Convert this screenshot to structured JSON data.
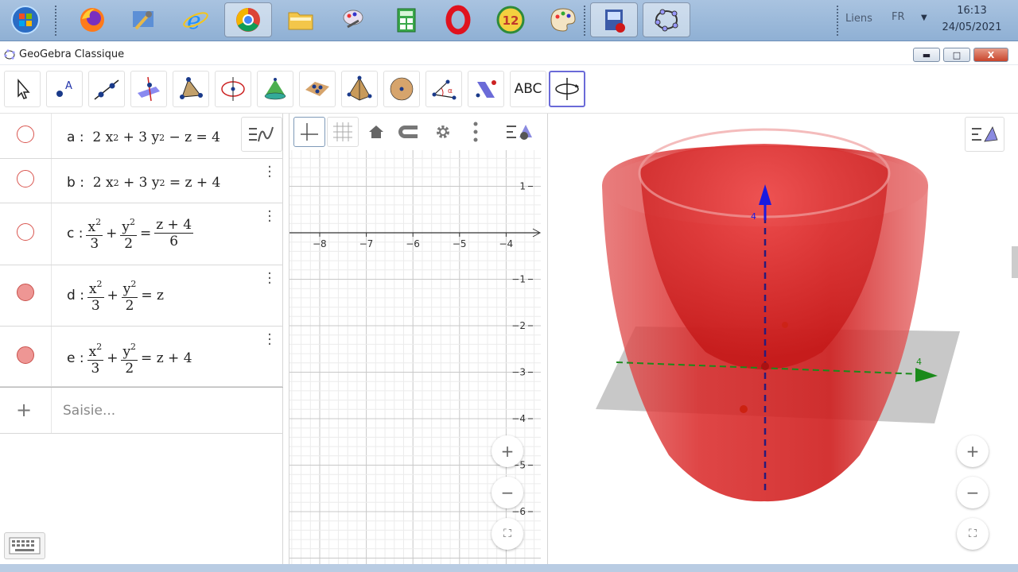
{
  "taskbar": {
    "apps": [
      "start-orb-icon",
      "firefox-icon",
      "app-settings-icon",
      "internet-explorer-icon",
      "chrome-icon",
      "folder-icon",
      "paint-icon",
      "calculator-icon",
      "opera-icon",
      "badge-12-icon",
      "palette-icon",
      "video-editor-icon",
      "geogebra-icon"
    ],
    "badge_number": "12",
    "links_label": "Liens",
    "language": "FR",
    "time": "16:13",
    "date": "24/05/2021"
  },
  "window": {
    "title": "GeoGebra Classique",
    "minimize_label": "▬",
    "maximize_label": "□",
    "close_label": "X"
  },
  "toolbar": {
    "tools": [
      "move-tool-icon",
      "point-tool-icon",
      "line-tool-icon",
      "perpendicular-tool-icon",
      "polygon-tool-icon",
      "circle-tool-icon",
      "cone-tool-icon",
      "plane-tool-icon",
      "pyramid-tool-icon",
      "sphere-tool-icon",
      "angle-tool-icon",
      "reflect-tool-icon",
      "text-tool",
      "rotate-view-tool-icon"
    ],
    "text_tool_label": "ABC",
    "undo_icon": "undo-icon",
    "redo_icon": "redo-icon",
    "search_icon": "search-icon",
    "menu_icon": "hamburger-menu-icon"
  },
  "algebra": {
    "rows": [
      {
        "name": "a",
        "visible": false,
        "expr": "a : 2 x² + 3 y² − z = 4"
      },
      {
        "name": "b",
        "visible": false,
        "expr": "b : 2 x² + 3 y² = z + 4"
      },
      {
        "name": "c",
        "visible": false,
        "expr": "c : x²/3 + y²/2 = (z + 4)/6"
      },
      {
        "name": "d",
        "visible": true,
        "expr": "d : x²/3 + y²/2 = z"
      },
      {
        "name": "e",
        "visible": true,
        "expr": "e : x²/3 + y²/2 = z + 4"
      }
    ],
    "labels": {
      "a": "a :",
      "b": "b :",
      "c": "c :",
      "d": "d :",
      "e": "e :"
    },
    "sq": "2",
    "three": "3",
    "two": "2",
    "six": "6",
    "z_plus_4": "z + 4",
    "z": "z",
    "equals": "=",
    "plus": "+",
    "x2": "x",
    "y2": "y",
    "input_placeholder": "Saisie..."
  },
  "graphics2d": {
    "x_ticks": [
      "−8",
      "−7",
      "−6",
      "−5",
      "−4"
    ],
    "y_ticks": [
      "1",
      "−1",
      "−2",
      "−3",
      "−4",
      "−5",
      "−6"
    ],
    "x_tick_values": [
      -8,
      -7,
      -6,
      -5,
      -4
    ],
    "y_tick_values": [
      1,
      -1,
      -2,
      -3,
      -4,
      -5,
      -6
    ]
  },
  "graphics3d": {
    "surface_color": "#d62020",
    "z_axis_color": "#1a1ae0",
    "y_axis_color": "#1a8a1a",
    "axis_label_z": "4",
    "axis_label_y": "4"
  },
  "zoom": {
    "in": "+",
    "out": "−"
  }
}
